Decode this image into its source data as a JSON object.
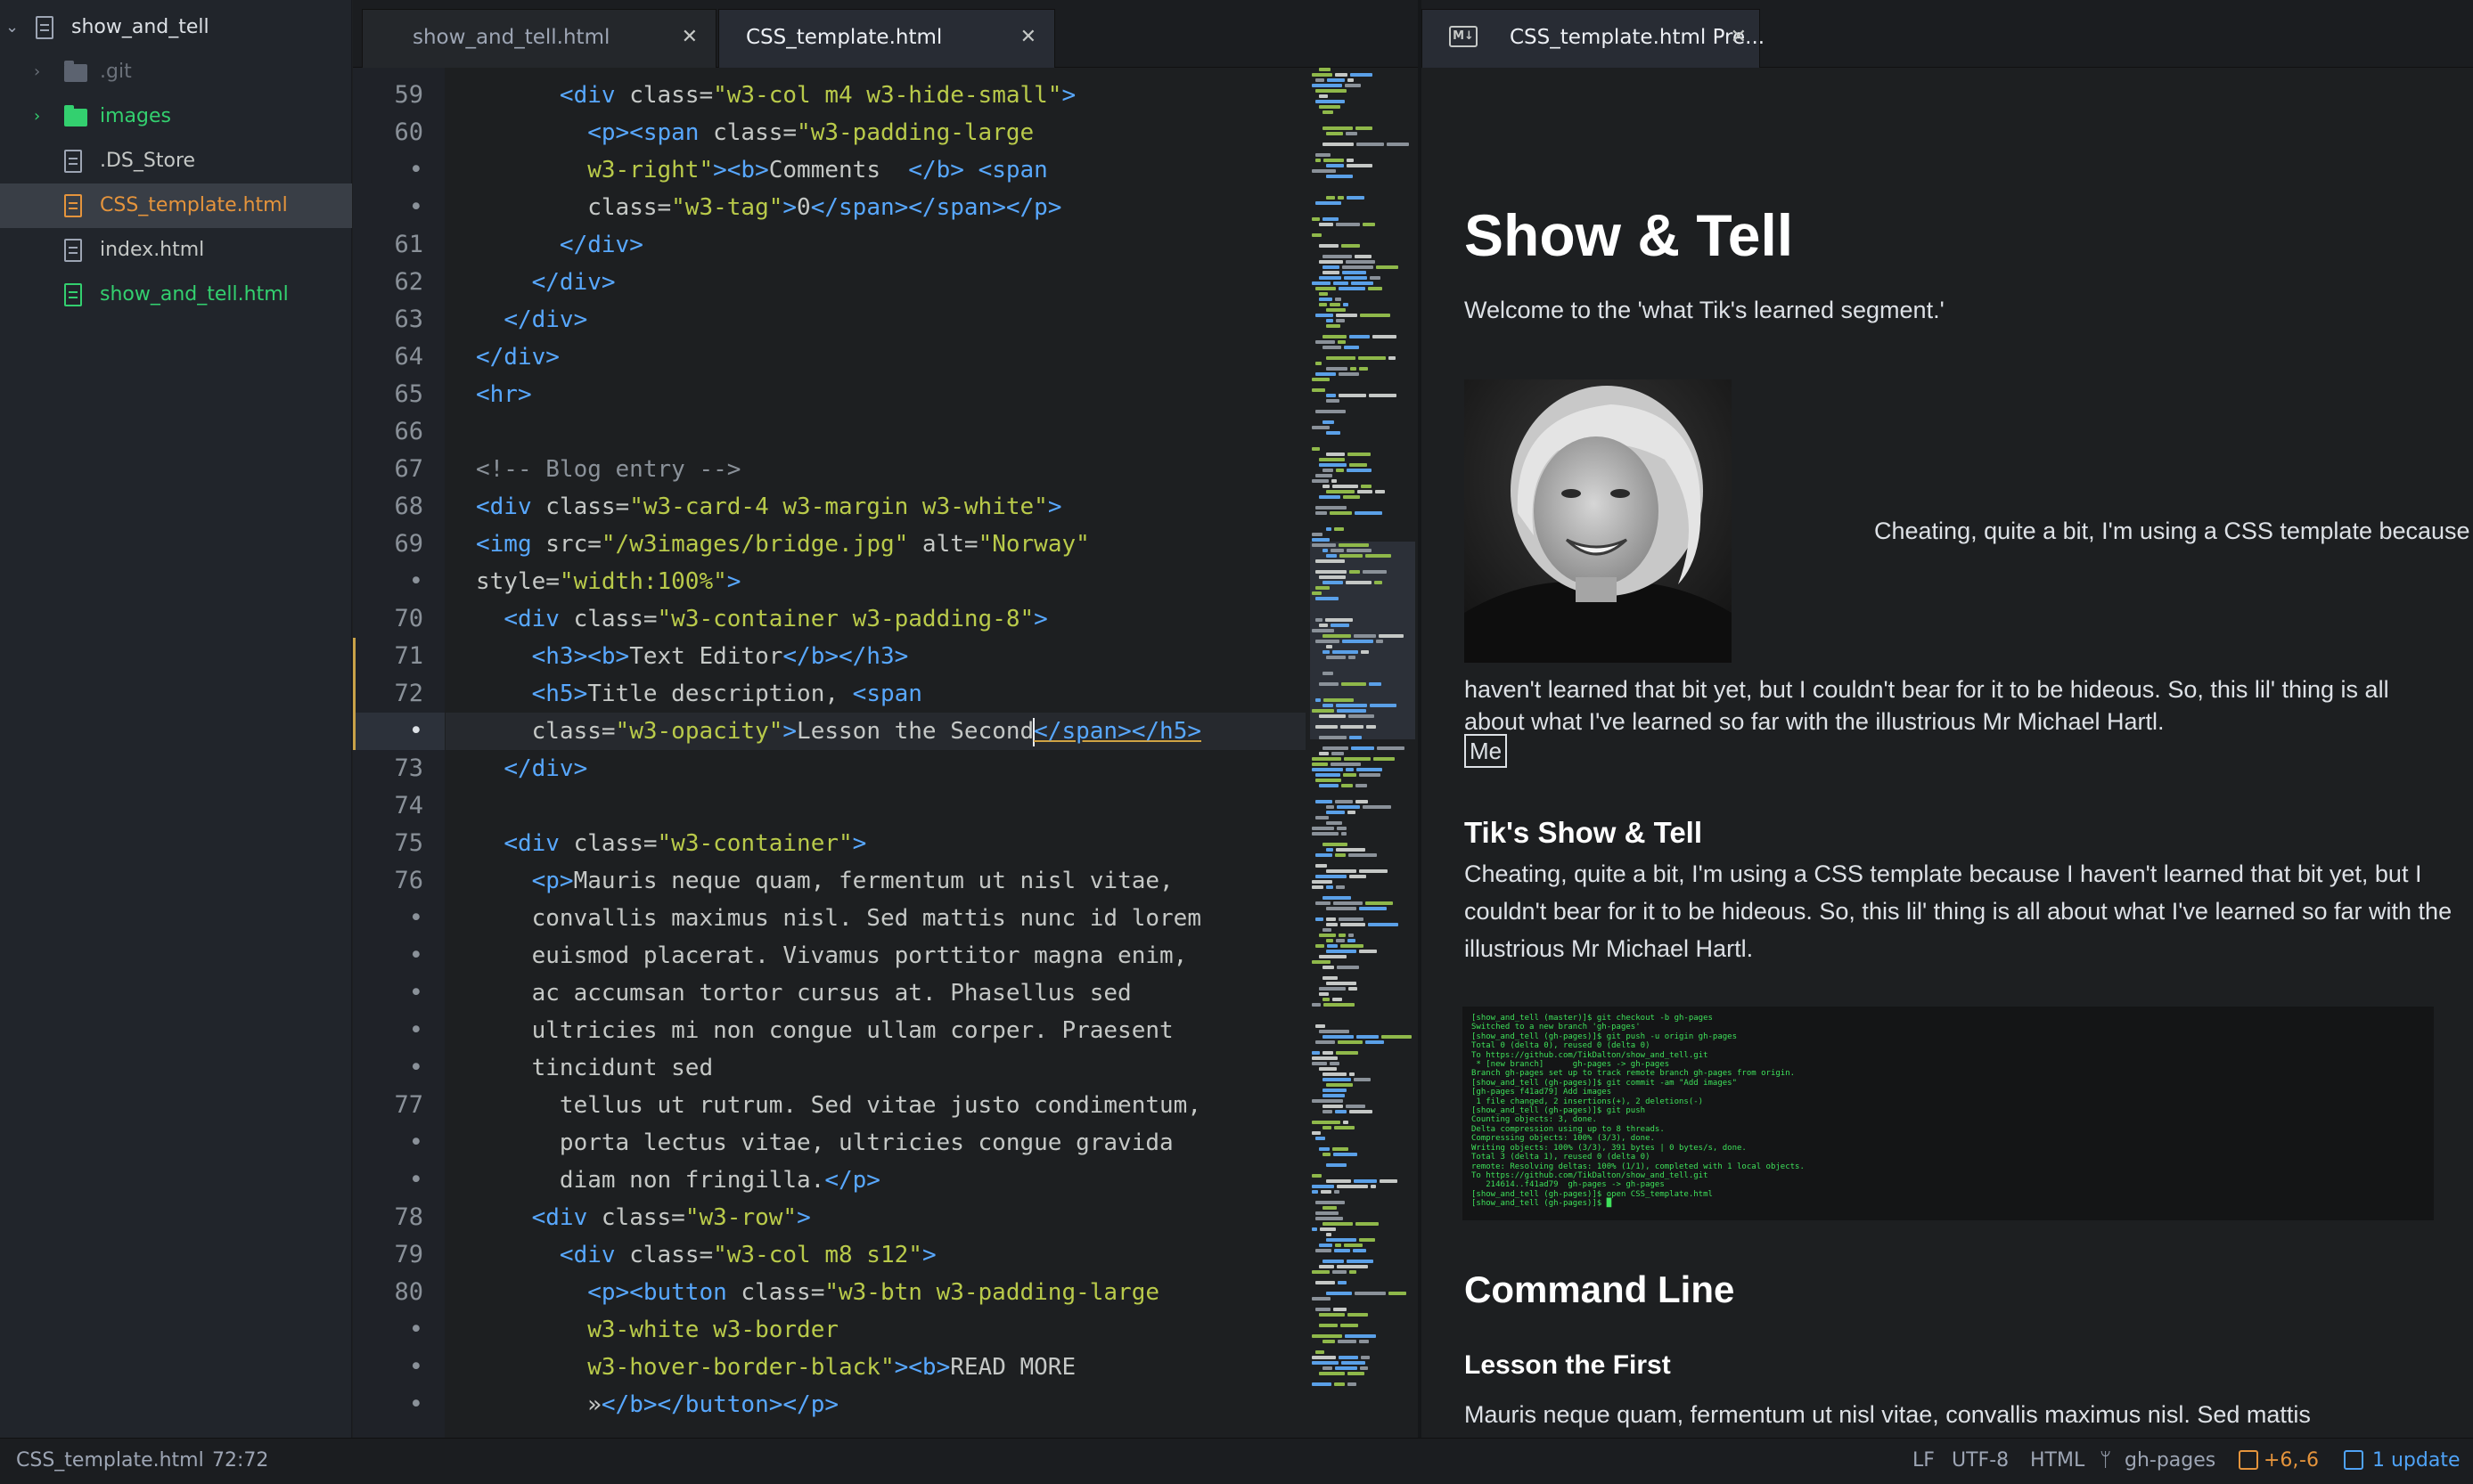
{
  "tree": {
    "root": "show_and_tell",
    "items": [
      {
        "name": ".git",
        "kind": "folder-muted"
      },
      {
        "name": "images",
        "kind": "folder-green"
      },
      {
        "name": ".DS_Store",
        "kind": "file"
      },
      {
        "name": "CSS_template.html",
        "kind": "file-orange",
        "selected": true
      },
      {
        "name": "index.html",
        "kind": "file"
      },
      {
        "name": "show_and_tell.html",
        "kind": "file-green"
      }
    ]
  },
  "tabs": [
    {
      "label": "show_and_tell.html",
      "active": false
    },
    {
      "label": "CSS_template.html",
      "active": true
    }
  ],
  "preview_tab": {
    "badge": "M↓",
    "label": "CSS_template.html Pre..."
  },
  "editor": {
    "gutter": [
      "59",
      "60",
      "•",
      "•",
      "61",
      "62",
      "63",
      "64",
      "65",
      "66",
      "67",
      "68",
      "69",
      "•",
      "70",
      "71",
      "72",
      "•",
      "73",
      "74",
      "75",
      "76",
      "•",
      "•",
      "•",
      "•",
      "•",
      "77",
      "•",
      "•",
      "78",
      "79",
      "80",
      "•",
      "•",
      "•"
    ],
    "lines": [
      [
        [
          "tx",
          "      "
        ],
        [
          "tg",
          "<div "
        ],
        [
          "at",
          "class="
        ],
        [
          "st",
          "\"w3-col m4 w3-hide-small\""
        ],
        [
          "tg",
          ">"
        ]
      ],
      [
        [
          "tx",
          "        "
        ],
        [
          "tg",
          "<p><span "
        ],
        [
          "at",
          "class="
        ],
        [
          "st",
          "\"w3-padding-large"
        ]
      ],
      [
        [
          "tx",
          "        "
        ],
        [
          "st",
          "w3-right\""
        ],
        [
          "tg",
          "><b>"
        ],
        [
          "tx",
          "Comments  "
        ],
        [
          "tg",
          "</b> <span"
        ]
      ],
      [
        [
          "tx",
          "        "
        ],
        [
          "at",
          "class="
        ],
        [
          "st",
          "\"w3-tag\""
        ],
        [
          "tg",
          ">"
        ],
        [
          "tx",
          "0"
        ],
        [
          "tg",
          "</span></span></p>"
        ]
      ],
      [
        [
          "tx",
          "      "
        ],
        [
          "tg",
          "</div>"
        ]
      ],
      [
        [
          "tx",
          "    "
        ],
        [
          "tg",
          "</div>"
        ]
      ],
      [
        [
          "tx",
          "  "
        ],
        [
          "tg",
          "</div>"
        ]
      ],
      [
        [
          "tg",
          "</div>"
        ]
      ],
      [
        [
          "tg",
          "<hr>"
        ]
      ],
      [
        [
          "tx",
          ""
        ]
      ],
      [
        [
          "cm",
          "<!-- Blog entry -->"
        ]
      ],
      [
        [
          "tg",
          "<div "
        ],
        [
          "at",
          "class="
        ],
        [
          "st",
          "\"w3-card-4 w3-margin w3-white\""
        ],
        [
          "tg",
          ">"
        ]
      ],
      [
        [
          "tg",
          "<img "
        ],
        [
          "at",
          "src="
        ],
        [
          "st",
          "\"/w3images/bridge.jpg\""
        ],
        [
          "at",
          " alt="
        ],
        [
          "st",
          "\"Norway\""
        ]
      ],
      [
        [
          "at",
          "style="
        ],
        [
          "st",
          "\"width:100%\""
        ],
        [
          "tg",
          ">"
        ]
      ],
      [
        [
          "tx",
          "  "
        ],
        [
          "tg",
          "<div "
        ],
        [
          "at",
          "class="
        ],
        [
          "st",
          "\"w3-container w3-padding-8\""
        ],
        [
          "tg",
          ">"
        ]
      ],
      [
        [
          "tx",
          "    "
        ],
        [
          "tg",
          "<h3><b>"
        ],
        [
          "tx",
          "Text Editor"
        ],
        [
          "tg",
          "</b></h3>"
        ]
      ],
      [
        [
          "tx",
          "    "
        ],
        [
          "tg",
          "<h5>"
        ],
        [
          "tx",
          "Title description, "
        ],
        [
          "tg",
          "<span"
        ]
      ],
      [
        [
          "tx",
          "    "
        ],
        [
          "at",
          "class="
        ],
        [
          "st",
          "\"w3-opacity\""
        ],
        [
          "tg",
          ">"
        ],
        [
          "tx",
          "Lesson the Second"
        ],
        [
          "caret",
          ""
        ],
        [
          "tg",
          "</span></h5>"
        ]
      ],
      [
        [
          "tx",
          "  "
        ],
        [
          "tg",
          "</div>"
        ]
      ],
      [
        [
          "tx",
          ""
        ]
      ],
      [
        [
          "tx",
          "  "
        ],
        [
          "tg",
          "<div "
        ],
        [
          "at",
          "class="
        ],
        [
          "st",
          "\"w3-container\""
        ],
        [
          "tg",
          ">"
        ]
      ],
      [
        [
          "tx",
          "    "
        ],
        [
          "tg",
          "<p>"
        ],
        [
          "tx",
          "Mauris neque quam, fermentum ut nisl vitae,"
        ]
      ],
      [
        [
          "tx",
          "    convallis maximus nisl. Sed mattis nunc id lorem"
        ]
      ],
      [
        [
          "tx",
          "    euismod placerat. Vivamus porttitor magna enim,"
        ]
      ],
      [
        [
          "tx",
          "    ac accumsan tortor cursus at. Phasellus sed"
        ]
      ],
      [
        [
          "tx",
          "    ultricies mi non congue ullam corper. Praesent"
        ]
      ],
      [
        [
          "tx",
          "    tincidunt sed"
        ]
      ],
      [
        [
          "tx",
          "      tellus ut rutrum. Sed vitae justo condimentum,"
        ]
      ],
      [
        [
          "tx",
          "      porta lectus vitae, ultricies congue gravida"
        ]
      ],
      [
        [
          "tx",
          "      diam non fringilla."
        ],
        [
          "tg",
          "</p>"
        ]
      ],
      [
        [
          "tx",
          "    "
        ],
        [
          "tg",
          "<div "
        ],
        [
          "at",
          "class="
        ],
        [
          "st",
          "\"w3-row\""
        ],
        [
          "tg",
          ">"
        ]
      ],
      [
        [
          "tx",
          "      "
        ],
        [
          "tg",
          "<div "
        ],
        [
          "at",
          "class="
        ],
        [
          "st",
          "\"w3-col m8 s12\""
        ],
        [
          "tg",
          ">"
        ]
      ],
      [
        [
          "tx",
          "        "
        ],
        [
          "tg",
          "<p><button "
        ],
        [
          "at",
          "class="
        ],
        [
          "st",
          "\"w3-btn w3-padding-large"
        ]
      ],
      [
        [
          "tx",
          "        "
        ],
        [
          "st",
          "w3-white w3-border"
        ]
      ],
      [
        [
          "tx",
          "        "
        ],
        [
          "st",
          "w3-hover-border-black\""
        ],
        [
          "tg",
          "><b>"
        ],
        [
          "tx",
          "READ MORE"
        ]
      ],
      [
        [
          "tx",
          "        »"
        ],
        [
          "tg",
          "</b></button></p>"
        ]
      ]
    ]
  },
  "preview": {
    "title": "Show & Tell",
    "welcome": "Welcome to the 'what Tik's learned segment.'",
    "intro_inline": "Cheating, quite a bit, I'm using a CSS template because I",
    "intro_rest": "haven't learned that bit yet, but I couldn't bear for it to be hideous. So, this lil' thing is all about what I've learned so far with the illustrious Mr Michael Hartl.",
    "me_button": "Me",
    "section_title": "Tik's Show & Tell",
    "section_body": "Cheating, quite a bit, I'm using a CSS template because I haven't learned that bit yet, but I couldn't bear for it to be hideous. So, this lil' thing is all about what I've learned so far with the illustrious Mr Michael Hartl.",
    "terminal_lines": [
      "[show_and_tell (master)]$ git checkout -b gh-pages",
      "Switched to a new branch 'gh-pages'",
      "[show_and_tell (gh-pages)]$ git push -u origin gh-pages",
      "Total 0 (delta 0), reused 0 (delta 0)",
      "To https://github.com/TikDalton/show_and_tell.git",
      " * [new branch]      gh-pages -> gh-pages",
      "Branch gh-pages set up to track remote branch gh-pages from origin.",
      "[show_and_tell (gh-pages)]$ git commit -am \"Add images\"",
      "[gh-pages f41ad79] Add images",
      " 1 file changed, 2 insertions(+), 2 deletions(-)",
      "[show_and_tell (gh-pages)]$ git push",
      "Counting objects: 3, done.",
      "Delta compression using up to 8 threads.",
      "Compressing objects: 100% (3/3), done.",
      "Writing objects: 100% (3/3), 391 bytes | 0 bytes/s, done.",
      "Total 3 (delta 1), reused 0 (delta 0)",
      "remote: Resolving deltas: 100% (1/1), completed with 1 local objects.",
      "To https://github.com/TikDalton/show_and_tell.git",
      "   214614..f41ad79  gh-pages -> gh-pages",
      "[show_and_tell (gh-pages)]$ open CSS_template.html",
      "[show_and_tell (gh-pages)]$ █"
    ],
    "h_command_line": "Command Line",
    "h_lesson": "Lesson the First",
    "lesson_text": "Mauris neque quam, fermentum ut nisl vitae, convallis maximus nisl. Sed mattis"
  },
  "status": {
    "file": "CSS_template.html",
    "cursor": "72:72",
    "eol": "LF",
    "encoding": "UTF-8",
    "grammar": "HTML",
    "branch": "gh-pages",
    "diff_added": "+6,",
    "diff_removed": "-6",
    "updates": "1 update"
  },
  "colors": {
    "tag": "#58a8ff",
    "string": "#b9ca4a",
    "comment": "#8a9199",
    "accent_orange": "#e5943c",
    "accent_green": "#33d06f",
    "update_blue": "#4fa3f7"
  }
}
